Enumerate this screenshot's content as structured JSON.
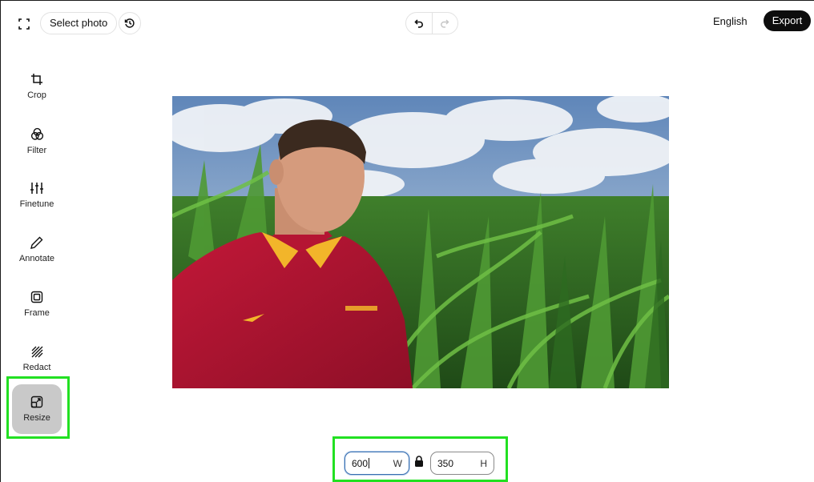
{
  "toolbar": {
    "select_photo_label": "Select photo",
    "language_label": "English",
    "export_label": "Export"
  },
  "sidebar": {
    "items": [
      {
        "label": "Crop",
        "icon": "crop-icon"
      },
      {
        "label": "Filter",
        "icon": "filter-icon"
      },
      {
        "label": "Finetune",
        "icon": "finetune-icon"
      },
      {
        "label": "Annotate",
        "icon": "pencil-icon"
      },
      {
        "label": "Frame",
        "icon": "frame-icon"
      },
      {
        "label": "Redact",
        "icon": "redact-icon"
      },
      {
        "label": "Resize",
        "icon": "resize-icon",
        "active": true
      }
    ]
  },
  "resize": {
    "width_value": "600",
    "width_unit": "W",
    "height_value": "350",
    "height_unit": "H"
  },
  "colors": {
    "accent_dark": "#0d0d0d",
    "active_tool_bg": "#c9c9c9",
    "highlight": "#22e022"
  }
}
